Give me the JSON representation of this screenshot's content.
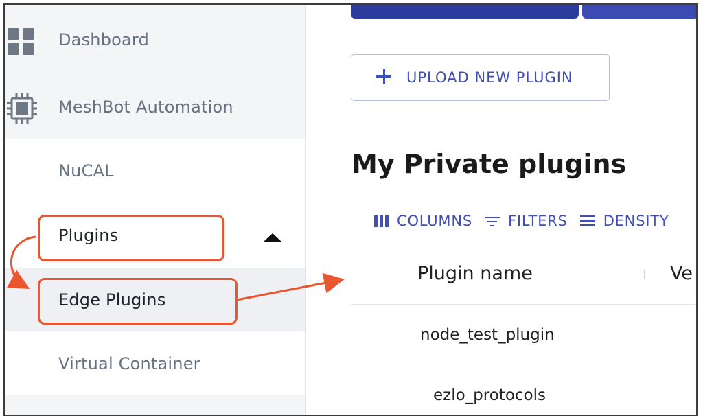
{
  "sidebar": {
    "items": [
      {
        "label": "Dashboard",
        "icon": "dashboard-icon"
      },
      {
        "label": "MeshBot Automation",
        "icon": "chip-icon"
      },
      {
        "label": "NuCAL"
      },
      {
        "label": "Plugins",
        "expanded": true
      },
      {
        "label": "Edge Plugins",
        "selected": true
      },
      {
        "label": "Virtual Container"
      }
    ]
  },
  "main": {
    "upload_label": "UPLOAD NEW PLUGIN",
    "title": "My Private plugins",
    "toolbar": {
      "columns": "COLUMNS",
      "filters": "FILTERS",
      "density": "DENSITY"
    },
    "table": {
      "headers": [
        "Plugin name",
        "Ve"
      ],
      "rows": [
        [
          "node_test_plugin"
        ],
        [
          "ezlo_protocols"
        ]
      ]
    }
  },
  "colors": {
    "accent": "#3f4fb8",
    "primary_button": "#2e3c9e",
    "annotation": "#e8572f",
    "sidebar_text": "#667282",
    "sidebar_bg": "#f4f5f7"
  }
}
